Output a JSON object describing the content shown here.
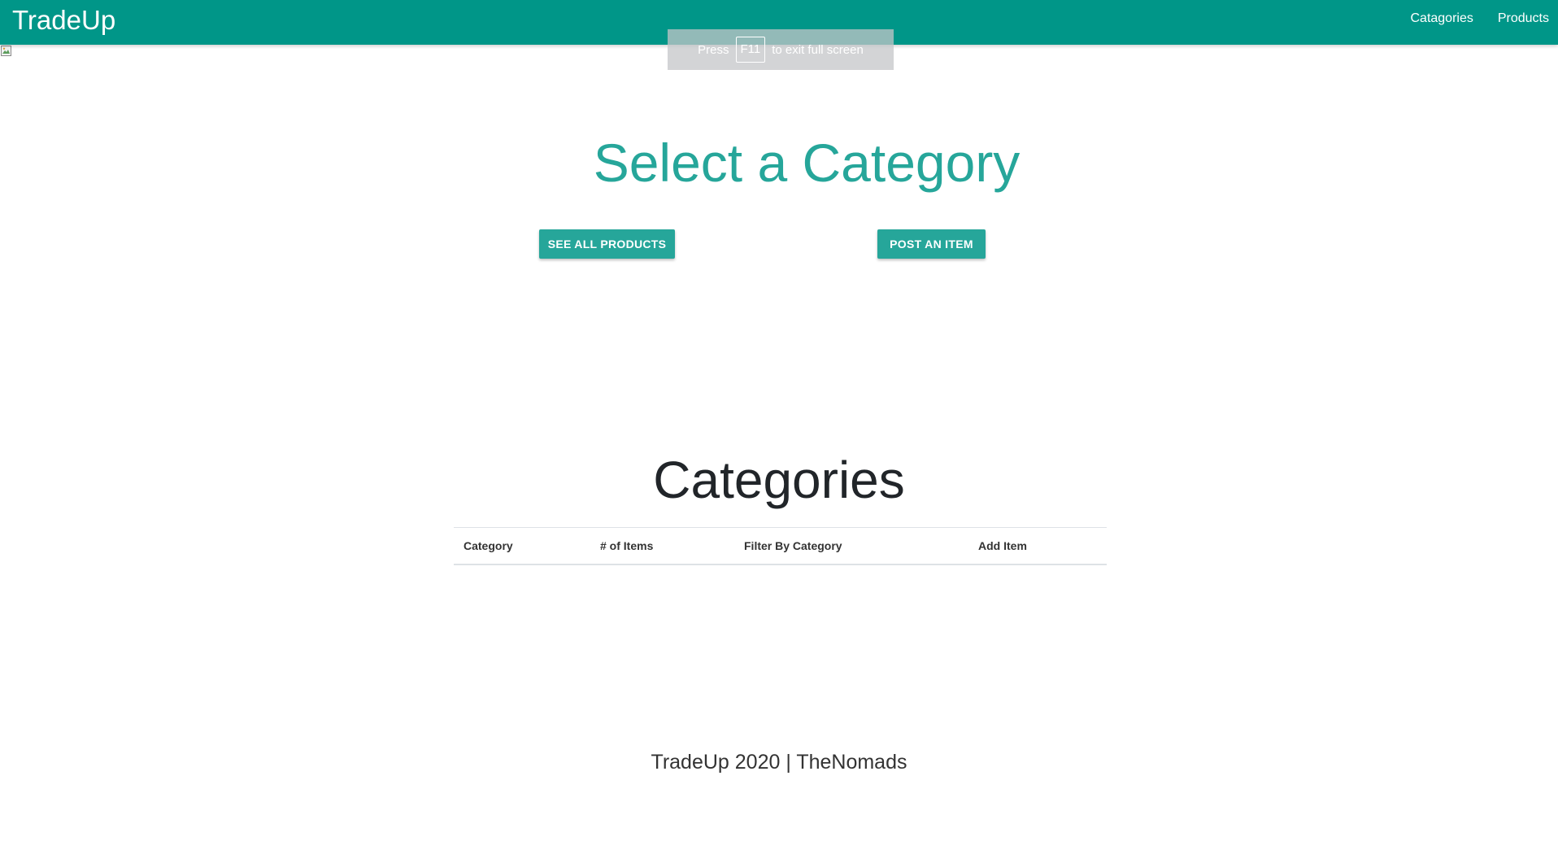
{
  "navbar": {
    "brand": "TradeUp",
    "links": [
      "Catagories",
      "Products"
    ],
    "bg_color": "#009688"
  },
  "fullscreen_notice": {
    "prefix": "Press",
    "key": "F11",
    "suffix": "to exit full screen"
  },
  "hero": {
    "title": "Select a Category",
    "title_color": "#26a69a",
    "see_all_label": "SEE ALL PRODUCTS",
    "post_label": "POST AN ITEM",
    "button_color": "#26a69a"
  },
  "categories": {
    "title": "Categories",
    "columns": [
      "Category",
      "# of Items",
      "Filter By Category",
      "Add Item"
    ],
    "rows": []
  },
  "footer": {
    "text": "TradeUp 2020 | TheNomads"
  }
}
